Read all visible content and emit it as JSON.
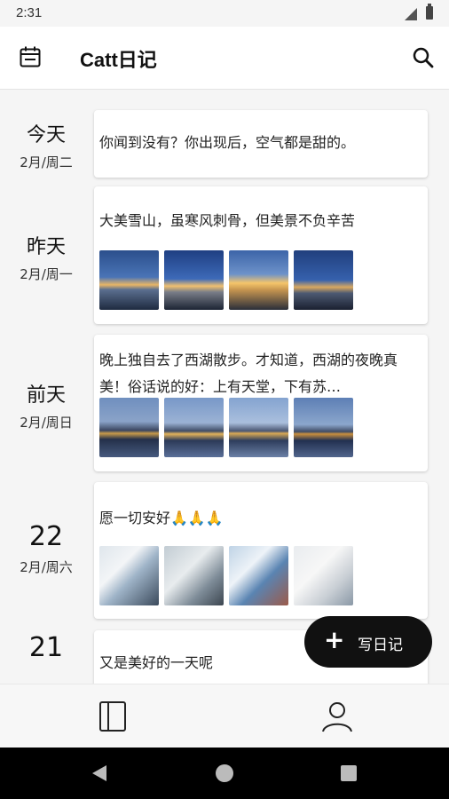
{
  "status_bar": {
    "time": "2:31"
  },
  "app_bar": {
    "title": "Catt日记"
  },
  "entries": [
    {
      "day": "今天",
      "sub": "2月/周二",
      "text": "你闻到没有？你出现后，空气都是甜的。",
      "photos": []
    },
    {
      "day": "昨天",
      "sub": "2月/周一",
      "text": "大美雪山，虽寒风刺骨，但美景不负辛苦",
      "photos": [
        "snow-mountain-1",
        "snow-mountain-2",
        "snow-mountain-3",
        "snow-mountain-4"
      ]
    },
    {
      "day": "前天",
      "sub": "2月/周日",
      "text": "晚上独自去了西湖散步。才知道，西湖的夜晚真美！俗话说的好：上有天堂，下有苏…",
      "photos": [
        "west-lake-1",
        "west-lake-2",
        "west-lake-3",
        "west-lake-4"
      ]
    },
    {
      "day": "22",
      "sub": "2月/周六",
      "text": "愿一切安好🙏🙏🙏",
      "photos": [
        "medical-team-1",
        "medical-team-2",
        "medical-team-3",
        "medical-team-4"
      ]
    },
    {
      "day": "21",
      "sub": "",
      "text": "又是美好的一天呢",
      "photos": []
    }
  ],
  "fab": {
    "label": "写日记",
    "icon": "plus-icon"
  },
  "bottom_nav": [
    {
      "name": "diary-book-tab",
      "icon": "book-icon"
    },
    {
      "name": "profile-tab",
      "icon": "person-icon"
    }
  ],
  "system_nav": [
    "back-icon",
    "home-icon",
    "recents-icon"
  ]
}
